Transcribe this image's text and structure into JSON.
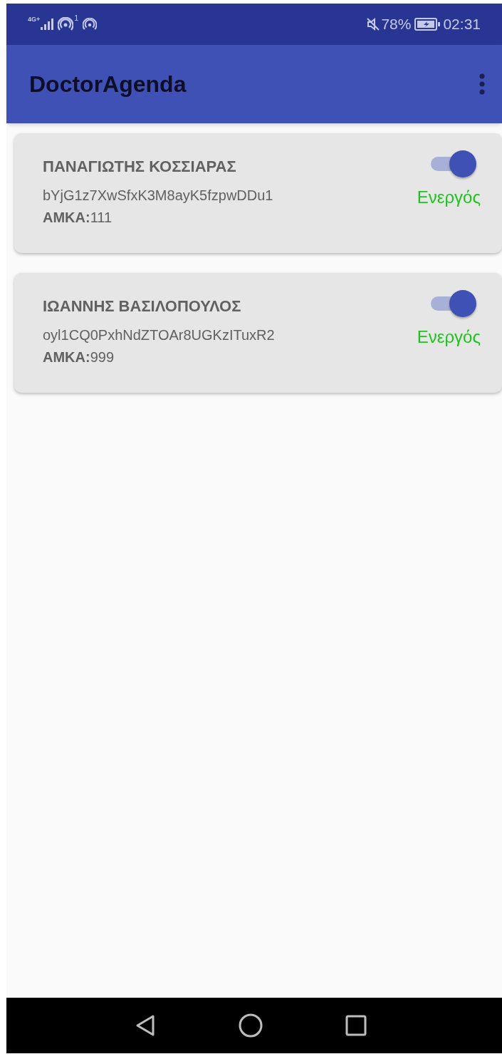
{
  "status_bar": {
    "network": "4G+",
    "hotspot_badge": "1",
    "battery": "78%",
    "time": "02:31",
    "muted": true
  },
  "app_bar": {
    "title": "DoctorAgenda"
  },
  "patients": [
    {
      "name": "ΠΑΝΑΓΙΩΤΗΣ ΚΟΣΣΙΑΡΑΣ",
      "uid": "bYjG1z7XwSfxK3M8ayK5fzpwDDu1",
      "amka": "**ΑΜΚΑ:**111",
      "on": true,
      "state_label": "Ενεργός"
    },
    {
      "name": "ΙΩΑΝΝΗΣ ΒΑΣΙΛΟΠΟΥΛΟΣ",
      "uid": "oyl1CQ0PxhNdZTOAr8UGKzITuxR2",
      "amka": "**ΑΜΚΑ:**999",
      "on": true,
      "state_label": "Ενεργός"
    }
  ]
}
